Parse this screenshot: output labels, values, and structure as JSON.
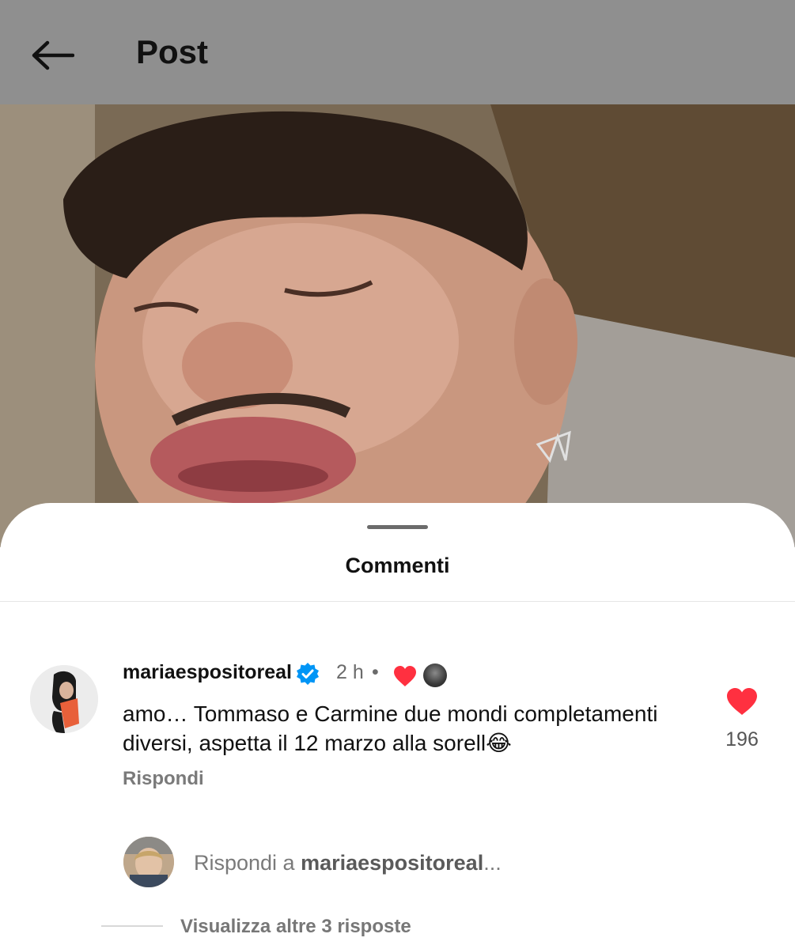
{
  "header": {
    "title": "Post",
    "back_icon": "arrow-left-icon"
  },
  "post_image": {
    "description_icon": "photo"
  },
  "comments_sheet": {
    "title": "Commenti",
    "comment": {
      "username": "mariaespositoreal",
      "verified": true,
      "time": "2 h",
      "separator": "•",
      "text": "amo… Tommaso e Carmine due mondi completamenti diversi, aspetta il 12 marzo alla sorell😂",
      "reply_label": "Rispondi",
      "like_count": "196",
      "like_color": "#ff3040",
      "verified_color": "#0095f6"
    },
    "reply_box": {
      "prefix": "Rispondi a ",
      "target": "mariaespositoreal",
      "suffix": "..."
    },
    "view_more": "Visualizza altre 3 risposte"
  }
}
